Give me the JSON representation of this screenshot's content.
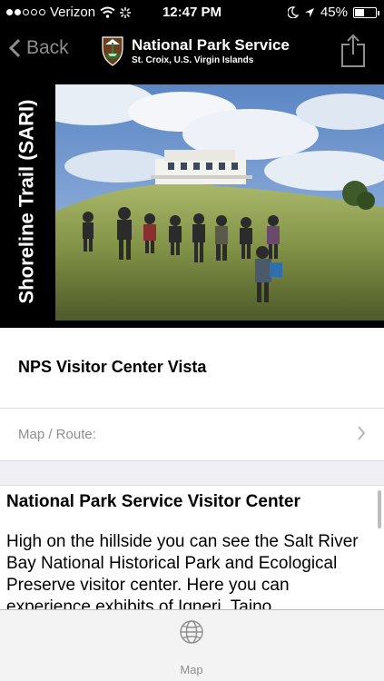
{
  "status_bar": {
    "carrier": "Verizon",
    "time": "12:47 PM",
    "battery": "45%",
    "battery_level": 0.45,
    "signal_bars": 2
  },
  "nav": {
    "back_label": "Back",
    "title": "National Park Service",
    "subtitle": "St. Croix, U.S. Virgin Islands"
  },
  "hero": {
    "side_label": "Shoreline Trail (SARI)"
  },
  "detail": {
    "place_title": "NPS Visitor Center Vista",
    "map_route_label": "Map / Route:",
    "section_heading": "National Park Service Visitor Center",
    "body": "High on the hillside you can see the Salt River Bay National Historical Park and Ecological Preserve visitor center. Here you can experience exhibits of Igneri, Taino"
  },
  "tab_bar": {
    "map_label": "Map"
  },
  "colors": {
    "bar_bg": "#000000",
    "secondary_text": "#8e8e8e",
    "separator_bg": "#efeff4"
  }
}
